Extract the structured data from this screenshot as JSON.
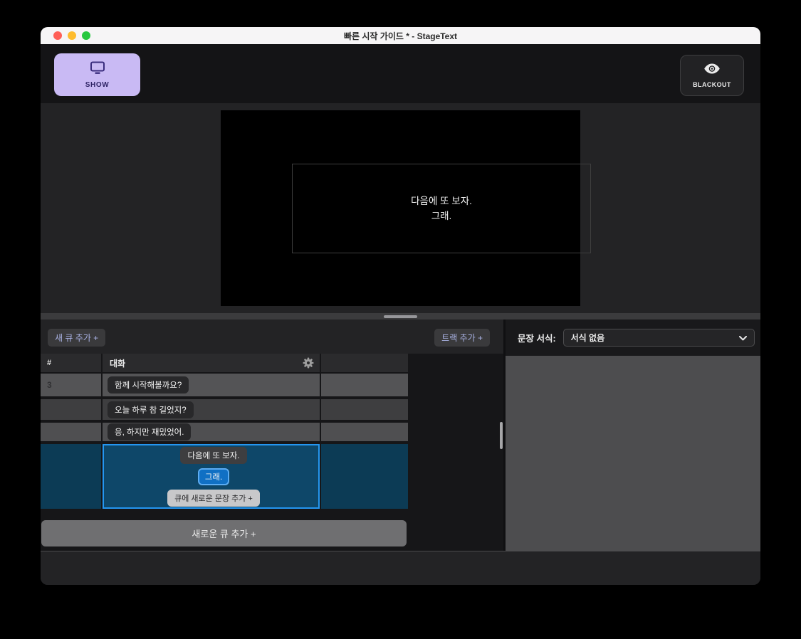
{
  "window": {
    "title": "빠른 시작 가이드 * - StageText"
  },
  "toolbar": {
    "show_button_label": "SHOW",
    "blackout_button_label": "BLACKOUT"
  },
  "preview": {
    "line1": "다음에 또 보자.",
    "line2": "그래."
  },
  "cue_panel": {
    "add_cue_button": "새 큐 추가 +",
    "add_track_button": "트랙 추가 +",
    "add_new_cue_button": "새로운 큐 추가 +",
    "table": {
      "col_number": "#",
      "col_track": "대화",
      "rows": [
        {
          "number": "3",
          "sentence": "함께 시작해볼까요?"
        },
        {
          "number": "",
          "sentence": "오늘 하루 참 길었지?"
        },
        {
          "number": "",
          "sentence": "응, 하지만 재밌었어."
        },
        {
          "number": "",
          "sentence_1": "다음에 또 보자.",
          "sentence_2": "그래.",
          "add_sentence_label": "큐에 새로운 문장 추가 +"
        }
      ]
    }
  },
  "format_panel": {
    "label": "문장 서식:",
    "dropdown_value": "서식 없음"
  },
  "colors": {
    "accent_purple": "#c9baf4",
    "selection_blue": "#2496f0",
    "selected_row_bg": "#0e4769",
    "active_sentence_bg": "#1070c4",
    "traffic_red": "#ff5f57",
    "traffic_yellow": "#febc2e",
    "traffic_green": "#28c840"
  }
}
